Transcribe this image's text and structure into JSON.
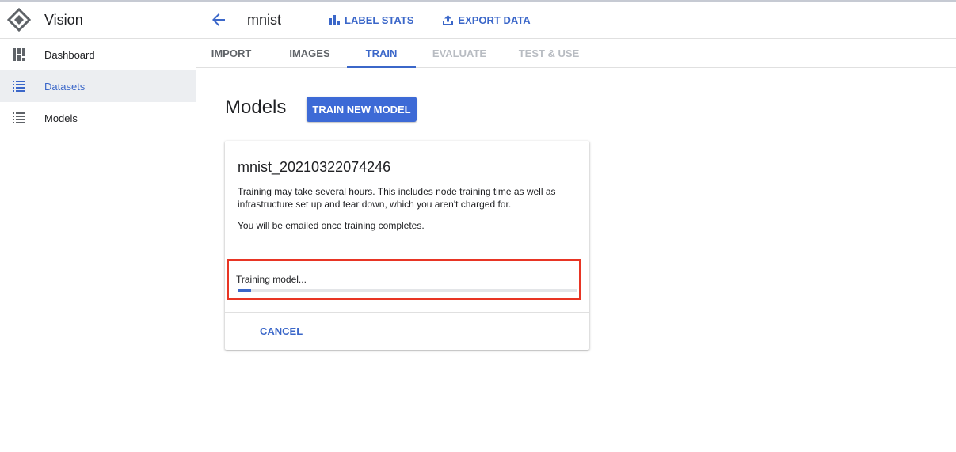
{
  "app": {
    "name": "Vision",
    "logo_icon": "vision-logo-icon"
  },
  "sidebar": {
    "items": [
      {
        "label": "Dashboard",
        "icon": "dashboard-icon",
        "active": false
      },
      {
        "label": "Datasets",
        "icon": "list-icon",
        "active": true
      },
      {
        "label": "Models",
        "icon": "list-icon",
        "active": false
      }
    ]
  },
  "header": {
    "dataset_name": "mnist",
    "back_icon": "arrow-back-icon",
    "actions": [
      {
        "label": "LABEL STATS",
        "icon": "bar-chart-icon"
      },
      {
        "label": "EXPORT DATA",
        "icon": "upload-icon"
      }
    ]
  },
  "tabs": [
    {
      "label": "IMPORT",
      "state": "normal"
    },
    {
      "label": "IMAGES",
      "state": "normal"
    },
    {
      "label": "TRAIN",
      "state": "active"
    },
    {
      "label": "EVALUATE",
      "state": "disabled"
    },
    {
      "label": "TEST & USE",
      "state": "disabled"
    }
  ],
  "main": {
    "title": "Models",
    "train_button_label": "TRAIN NEW MODEL",
    "card": {
      "model_name": "mnist_20210322074246",
      "description": "Training may take several hours. This includes node training time as well as infrastructure set up and tear down, which you aren't charged for.",
      "email_note": "You will be emailed once training completes.",
      "progress_label": "Training model...",
      "progress_fraction": 0.04,
      "cancel_label": "CANCEL"
    }
  },
  "colors": {
    "accent": "#3b67c9",
    "primary_button": "#3d6ad6",
    "highlight_box": "#e83524",
    "active_nav_bg": "#eceef1"
  }
}
